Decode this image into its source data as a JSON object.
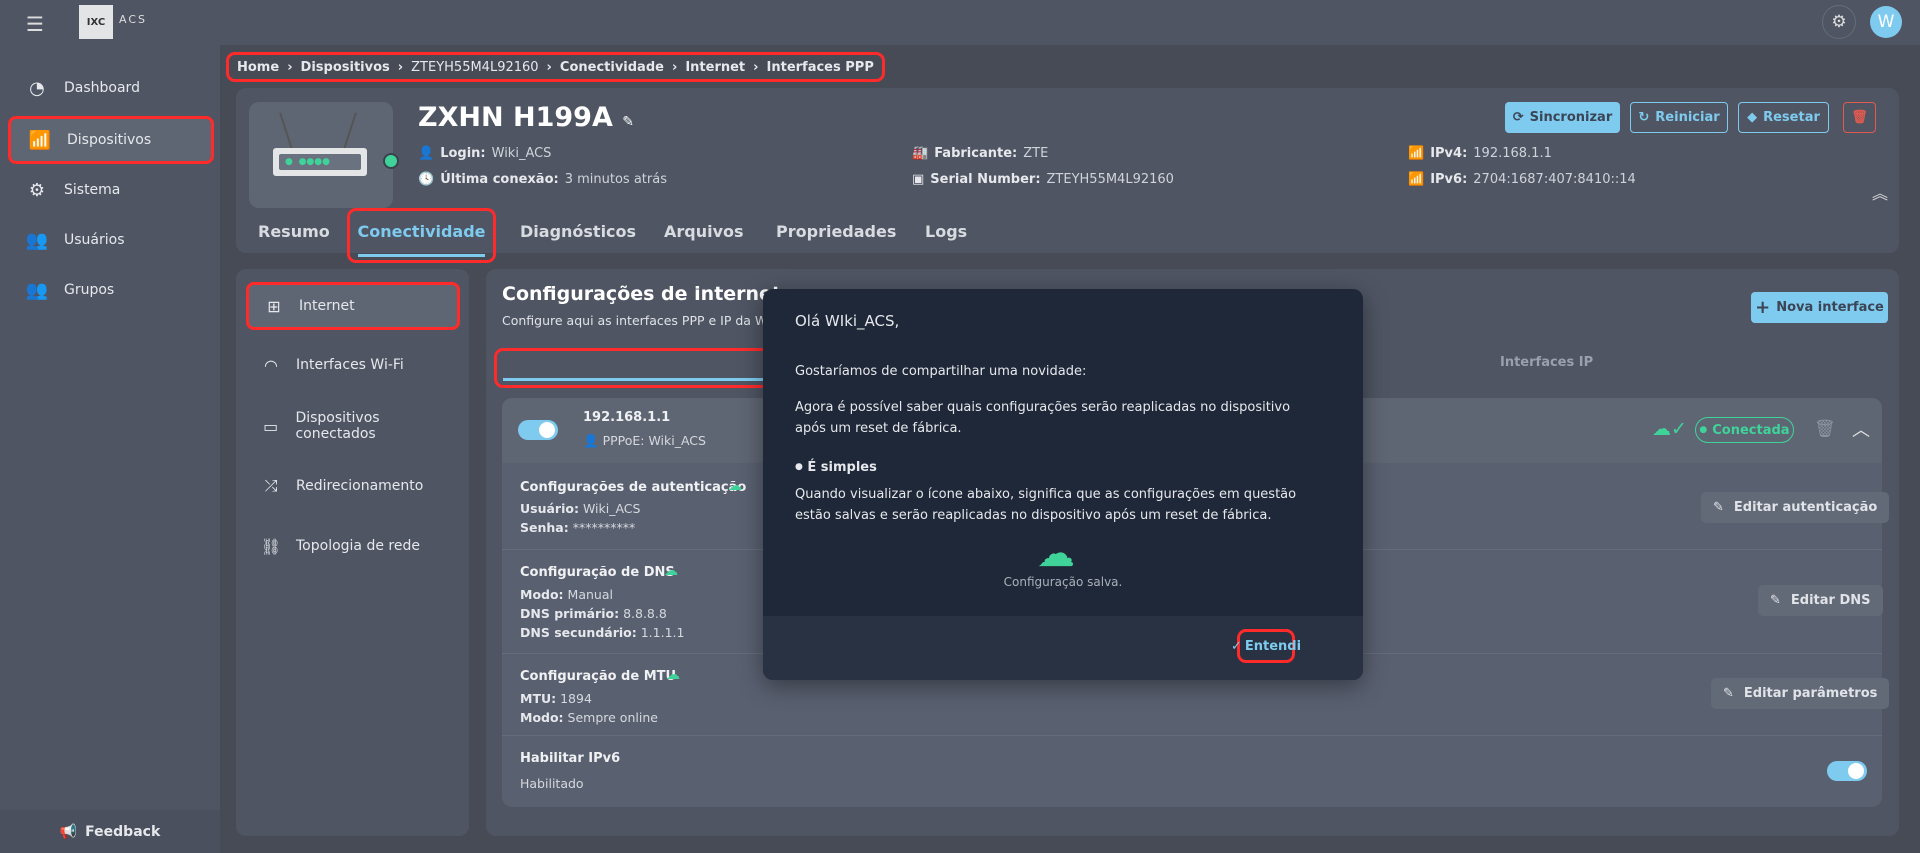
{
  "topbar": {
    "logo_text": "IXC",
    "logo_sub": "ACS",
    "avatar": "W"
  },
  "sidebar": {
    "items": [
      {
        "label": "Dashboard",
        "icon": "pie-chart-icon"
      },
      {
        "label": "Dispositivos",
        "icon": "router-icon"
      },
      {
        "label": "Sistema",
        "icon": "gear-icon"
      },
      {
        "label": "Usuários",
        "icon": "users-icon"
      },
      {
        "label": "Grupos",
        "icon": "groups-icon"
      }
    ],
    "feedback": "Feedback"
  },
  "breadcrumb": [
    "Home",
    "Dispositivos",
    "ZTEYH55M4L92160",
    "Conectividade",
    "Internet",
    "Interfaces PPP"
  ],
  "device": {
    "name": "ZXHN H199A",
    "login_label": "Login:",
    "login": "Wiki_ACS",
    "last_label": "Última conexão:",
    "last": "3 minutos atrás",
    "maker_label": "Fabricante:",
    "maker": "ZTE",
    "serial_label": "Serial Number:",
    "serial": "ZTEYH55M4L92160",
    "ipv4_label": "IPv4:",
    "ipv4": "192.168.1.1",
    "ipv6_label": "IPv6:",
    "ipv6": "2704:1687:407:8410::14",
    "status_color": "#3fd39a"
  },
  "actions": {
    "sync": "Sincronizar",
    "restart": "Reiniciar",
    "reset": "Resetar"
  },
  "tabs": [
    "Resumo",
    "Conectividade",
    "Diagnósticos",
    "Arquivos",
    "Propriedades",
    "Logs"
  ],
  "left_menu": [
    "Internet",
    "Interfaces Wi-Fi",
    "Dispositivos conectados",
    "Redirecionamento",
    "Topologia de rede"
  ],
  "main": {
    "title": "Configurações de internet",
    "subtitle": "Configure aqui as interfaces PPP e IP da WAN",
    "new_button": "Nova interface",
    "subtab_ip": "Interfaces IP"
  },
  "interface": {
    "ip": "192.168.1.1",
    "pppoe": "PPPoE: Wiki_ACS",
    "status": "Conectada",
    "enabled": true,
    "auth": {
      "title": "Configurações de autenticação",
      "user_label": "Usuário:",
      "user": "Wiki_ACS",
      "pass_label": "Senha:",
      "pass": "**********",
      "edit": "Editar autenticação"
    },
    "dns": {
      "title": "Configuração de DNS",
      "mode_label": "Modo:",
      "mode": "Manual",
      "p_label": "DNS primário:",
      "p": "8.8.8.8",
      "s_label": "DNS secundário:",
      "s": "1.1.1.1",
      "edit": "Editar DNS"
    },
    "mtu": {
      "title": "Configuração de MTU",
      "mtu_label": "MTU:",
      "mtu": "1894",
      "mode_label": "Modo:",
      "mode": "Sempre online",
      "edit": "Editar parâmetros"
    },
    "ipv6": {
      "title": "Habilitar IPv6",
      "value": "Habilitado",
      "enabled": true
    }
  },
  "modal": {
    "greeting": "Olá WIki_ACS,",
    "p1": "Gostaríamos de compartilhar uma novidade:",
    "p2": "Agora é possível saber quais configurações serão reaplicadas no dispositivo após um reset de fábrica.",
    "bullet": "É simples",
    "p3": "Quando visualizar o ícone abaixo, significa que as configurações em questão estão salvas e serão reaplicadas no dispositivo após um reset de fábrica.",
    "icon_caption": "Configuração salva.",
    "ok": "Entendi"
  },
  "colors": {
    "accent": "#7ecbef",
    "success": "#3fd39a",
    "danger": "#e05a4f",
    "highlight": "#ff2b2b"
  }
}
